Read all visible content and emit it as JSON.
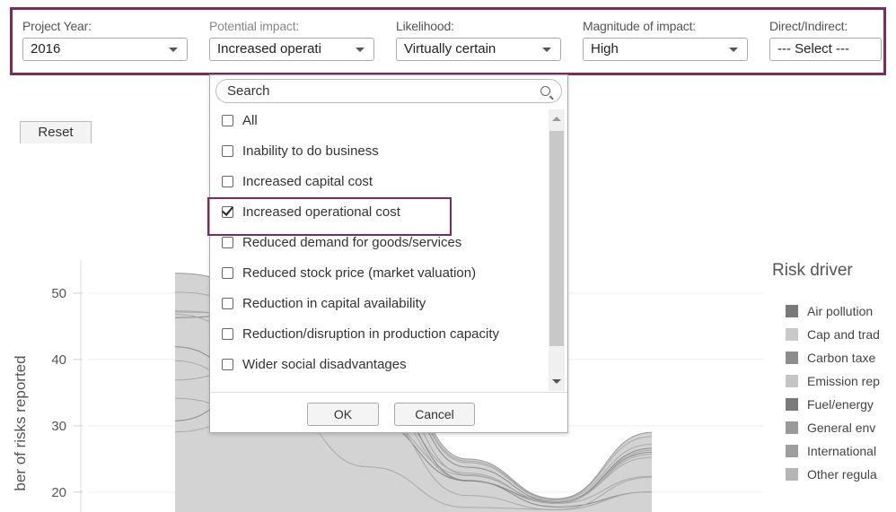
{
  "filters": [
    {
      "label": "Project Year:",
      "value": "2016"
    },
    {
      "label": "Potential impact:",
      "value": "Increased operati"
    },
    {
      "label": "Likelihood:",
      "value": "Virtually certain"
    },
    {
      "label": "Magnitude of impact:",
      "value": "High"
    },
    {
      "label": "Direct/Indirect:",
      "value": "--- Select ---"
    }
  ],
  "reset_label": "Reset",
  "dropdown": {
    "search_placeholder": "Search",
    "options": [
      {
        "label": "All",
        "checked": false
      },
      {
        "label": "Inability to do business",
        "checked": false
      },
      {
        "label": "Increased capital cost",
        "checked": false
      },
      {
        "label": "Increased operational cost",
        "checked": true
      },
      {
        "label": "Reduced demand for goods/services",
        "checked": false
      },
      {
        "label": "Reduced stock price (market valuation)",
        "checked": false
      },
      {
        "label": "Reduction in capital availability",
        "checked": false
      },
      {
        "label": "Reduction/disruption in production capacity",
        "checked": false
      },
      {
        "label": "Wider social disadvantages",
        "checked": false
      }
    ],
    "ok_label": "OK",
    "cancel_label": "Cancel"
  },
  "chart_data": {
    "type": "area",
    "ylabel": "ber of risks reported",
    "y_ticks": [
      20,
      30,
      40,
      50
    ],
    "ylim": [
      17,
      55
    ],
    "legend_title": "Risk driver",
    "legend": [
      {
        "name": "Air pollution",
        "color": "#7a7a7a"
      },
      {
        "name": "Cap and trad",
        "color": "#c9c9c9"
      },
      {
        "name": "Carbon taxe",
        "color": "#8c8c8c"
      },
      {
        "name": "Emission rep",
        "color": "#c4c4c4"
      },
      {
        "name": "Fuel/energy",
        "color": "#7a7a7a"
      },
      {
        "name": "General env",
        "color": "#9a9a9a"
      },
      {
        "name": "International",
        "color": "#9e9e9e"
      },
      {
        "name": "Other regula",
        "color": "#b5b5b5"
      }
    ],
    "x_points": [
      0,
      1,
      2,
      3,
      4,
      5
    ],
    "total": [
      53,
      51,
      45,
      25,
      19,
      29
    ]
  }
}
